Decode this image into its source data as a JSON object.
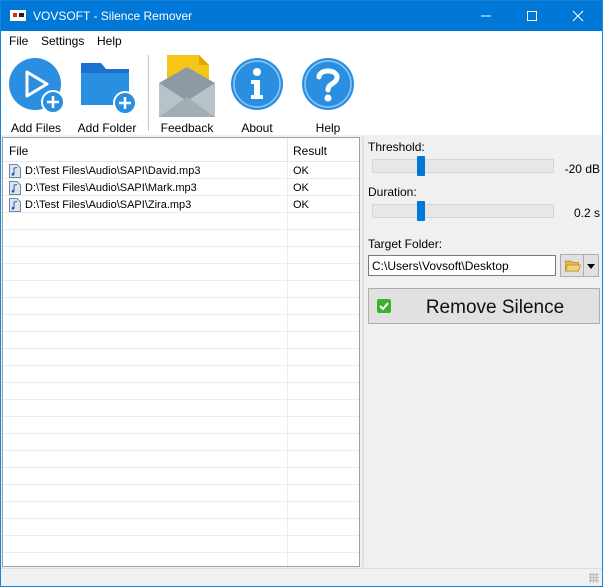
{
  "window": {
    "title": "VOVSOFT - Silence Remover",
    "controls": {
      "minimize": "minimize-icon",
      "maximize": "maximize-icon",
      "close": "close-icon"
    }
  },
  "menu": [
    "File",
    "Settings",
    "Help"
  ],
  "toolbar": {
    "add_files": "Add Files",
    "add_folder": "Add Folder",
    "feedback": "Feedback",
    "about": "About",
    "help": "Help"
  },
  "file_list": {
    "columns": {
      "file": "File",
      "result": "Result"
    },
    "rows": [
      {
        "file": "D:\\Test Files\\Audio\\SAPI\\David.mp3",
        "result": "OK"
      },
      {
        "file": "D:\\Test Files\\Audio\\SAPI\\Mark.mp3",
        "result": "OK"
      },
      {
        "file": "D:\\Test Files\\Audio\\SAPI\\Zira.mp3",
        "result": "OK"
      }
    ]
  },
  "settings": {
    "threshold_label": "Threshold:",
    "threshold_value": "-20 dB",
    "threshold_position": 0.26,
    "duration_label": "Duration:",
    "duration_value": "0.2 s",
    "duration_position": 0.26,
    "target_folder_label": "Target Folder:",
    "target_folder_value": "C:\\Users\\Vovsoft\\Desktop"
  },
  "remove_button": {
    "label": "Remove Silence"
  },
  "colors": {
    "titlebar": "#0078d7",
    "accent_blue": "#2a8fe0",
    "check_green": "#3cb12e",
    "feedback_yellow": "#f5c518"
  }
}
